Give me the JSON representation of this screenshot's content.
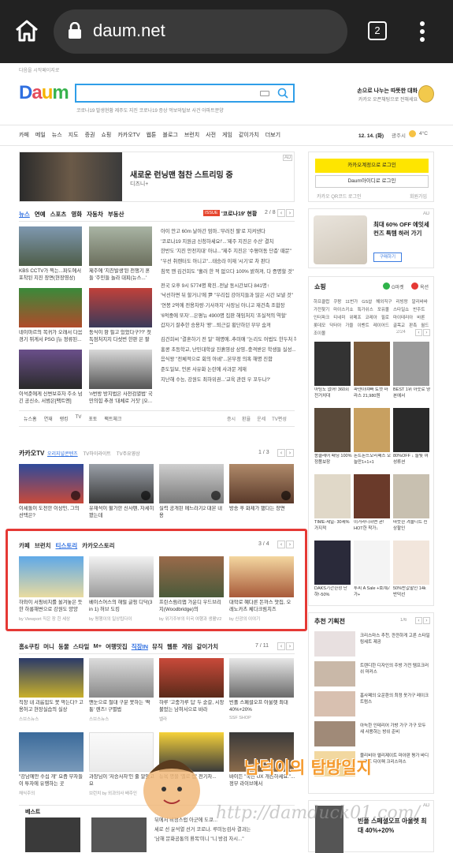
{
  "browser": {
    "url": "daum.net",
    "tab_count": "2"
  },
  "header": {
    "top_link": "다음을 시작페이지로",
    "logo": "Daum",
    "search_placeholder": "",
    "keywords": "코로나19 발생현황   제주도 지진   코로나19 증상   먹보와털보 사건  아파트분양",
    "promo_line1": "손으로 나누는 따뜻한 대화",
    "promo_line2": "카카오 오픈채팅으로 전해세요"
  },
  "gnb": {
    "items": [
      "카페",
      "메일",
      "뉴스",
      "지도",
      "증권",
      "쇼핑",
      "카카오TV",
      "웹툰",
      "블로그",
      "브런치",
      "사전",
      "게임",
      "같이가치",
      "더보기"
    ],
    "date": "12. 14. (화)",
    "weather_loc": "광주시",
    "temp": "4°C"
  },
  "banner": {
    "title": "새로운 런닝맨 첨찬 스트리밍 중",
    "sub": "디즈니+",
    "ad": "AD"
  },
  "login": {
    "kakao_btn": "카카오계정으로 로그인",
    "daum_btn": "Daum아이디로 로그인",
    "qr": "카카오 QR코드 로그인",
    "signup": "회원가입"
  },
  "news": {
    "tabs": [
      "뉴스",
      "연예",
      "스포츠",
      "영화",
      "자동차",
      "부동산"
    ],
    "issue_label": "ISSUE",
    "issue_text": "'코로나19' 현황",
    "page": "2 / 8",
    "thumbs": [
      {
        "cap": "KBS CCTV가 찍는...파도에서 포착된 지진 장면(현장영상)"
      },
      {
        "cap": "제주에 '지진발생'된 전쟁기 혼들 '주민들 놀라 대피(뉴스...'"
      },
      {
        "cap": "네이마르의 복귀가 오래서 다음 경기 뛰게서 PSG [뉴 정류된..."
      },
      {
        "cap": "동식이 항 필고 있었다구??' 첫 독점처지지 다섯번 한판 은 팔렸..."
      },
      {
        "cap": "이석준에게 신변보호자 주소 넘긴 공신소, 서범은[팩트엔]"
      },
      {
        "cap": "'n번방 방지법은 사전검열법' 국민의힘 추경 '대체로 거짓' [오..."
      }
    ],
    "lines": [
      "아이 안고 60m 날아간 엄마..'부러진 팔'로 지켜낸다",
      "'코로나19 지원금 신청하세요!'...'제주 지진은 수산' 결치",
      "한반도 '지진 안전지대' 아냐...\"제주 지진은 '수평이동 단층' 때문\"",
      "\"우선 취렌터도 아니고\"...태승라 이재 '시기'로 차 판다",
      "침묵 깬 김건희도 \"흘러 한 적 없으다 100% 밝혀져, 다 증명할 것\"",
      "",
      "전국 오후 9시 5774명 확진..전날 동시간보다 841명↑",
      "'낙선하면 뒤 할거니'에 尹 \"우리집 강아지들과 많은 시간 보낼 것\"",
      "'연봉 2억에 전용차량·기사까지' 사장님 아니고 재건축 조합장",
      "'6억중에 또자'...은평뉴 4900명 집판 해임처지 '초실적의 역할'",
      "갑자기 잘추한 승용차 '꽝'...퇴근길 횡단하던 부부 숨져",
      "",
      "김건희씨 \"결혼하기 전 일\" 해명에..추미애 \"논리도 어법도 한두처 헤\"",
      "홍콩 초등학교, 난민대학살 진흙영상 상영..충격받은 학생들 실성...",
      "음식왕 \"전체적으로 회의 아녜\"...본부정 의혹 해명 진함",
      "준도일보, 언론 사유화 논란에 사과문 게재",
      "지난해 수능, 강원도 최하위권...'교육 관련 우 꼬두나?'"
    ],
    "sub_tabs": [
      "뉴스홈",
      "연재",
      "랭킹",
      "TV",
      "포토",
      "팩트체크"
    ],
    "right_links": [
      "증시",
      "환율",
      "운세",
      "TV편성"
    ]
  },
  "kakaotv": {
    "title": "카카오TV",
    "tabs": [
      "오리지널콘텐츠",
      "TV하이라이트",
      "TV주요영상"
    ],
    "page": "1 / 3",
    "items": [
      {
        "cap": "이세돌이 도전한 이상민, 그의 선택은?"
      },
      {
        "cap": "유재석이 뮐가한 신사펜, 자세히 봤는데"
      },
      {
        "cap": "실력 공개된 메느라기2 대본 내용"
      },
      {
        "cap": "방송 후 화제가 됐다는 장면"
      }
    ]
  },
  "cafe": {
    "tabs": [
      "카페",
      "브런치",
      "티스토리",
      "카카오스토리"
    ],
    "page": "3 / 4",
    "items": [
      {
        "cap": "하와이 서핑비치를 올겨놓은 듯한 하롱해변으로 강원도 양양",
        "src": "by Viewport 직은 장 힌 세상"
      },
      {
        "cap": "베이스어스의 해럴 글핑 디닥(3 in 1) 허브 도킹",
        "src": "by 평행이의 일상팁다이"
      },
      {
        "cap": "프린스림리앱 가운디 우드브리지(Woodbridge)의",
        "src": "by 위기주부의 미국 여행과 생활V2"
      },
      {
        "cap": "대학로 혜다른 돈까스 맛집, 오레노카츠 체다크림치즈",
        "src": "by 신광의 이야기"
      }
    ]
  },
  "lifestyle": {
    "tabs": [
      "홈&쿠킹",
      "머니",
      "동물",
      "스타일",
      "M+",
      "여행맛집",
      "직장IN",
      "뮤직",
      "웹툰",
      "게임",
      "같이가치"
    ],
    "page": "7 / 11",
    "items": [
      {
        "cap": "직장 내 괴롭힘도 못 막는다? 고용허고 현장실습의 실상",
        "src": "스브스뉴스"
      },
      {
        "cap": "맨눈으로 절대 구분 못하는 '짝퉁' 렌즈! 구별법",
        "src": "스브스뉴스"
      },
      {
        "cap": "하루 '고충가루 딥' 두 숟갈, 시장 불었는 남혀서으로 바라",
        "src": "벨라"
      },
      {
        "cap": "빈폴 스페셜오프 아울렛 최대 40%+20%",
        "src": "SSF SHOP"
      },
      {
        "cap": "\"강남에만 수십 개\" 요즘 부자들이 투자에 유행하는 곳",
        "src": "채식주의"
      },
      {
        "cap": "과장님이 '저승사자'인 줄 알았고요",
        "src": "브런치 by 외과의사 배주인"
      },
      {
        "cap": "뉴욕 명물 '옐로 캡' 전기차...",
        "src": ""
      },
      {
        "cap": "바이든 \"국민 UX 개선하세요.\"...정부 라이브에서",
        "src": ""
      }
    ]
  },
  "best": {
    "title": "베스트",
    "lines": [
      "뒤에서 비정스럽 아군에 도쿄...",
      "세로 선 윤석열 선거 코로나. 루미능검사 결과는",
      "'남해 문화공통의 환복'미니 \"니 방검 자시...\""
    ]
  },
  "ad_right": {
    "title": "최대 60% OFF 에잇세컨즈 특템 하러 가기",
    "btn": "구매하기",
    "ad": "AD"
  },
  "shopping": {
    "title": "쇼핑",
    "g": "G마켓",
    "o": "옥션",
    "links": [
      "하프클럽",
      "쿠팡",
      "11번가",
      "GS샵",
      "해외직구",
      "리빙랑",
      "알리바바",
      "가전찾기",
      "마이스키쇼",
      "특가쉬스",
      "포유몰",
      "스타일쇼",
      "반주트",
      "인터파크",
      "티네미",
      "위메프",
      "코레아",
      "필로",
      "마이테리아",
      "바론",
      "롯데모",
      "닥터아",
      "가을",
      "이벤트",
      "레이어드",
      "골목교",
      "판촉",
      "월드",
      "조이몰"
    ],
    "page": "2/24",
    "items": [
      {
        "cap": "아팅도 없어! 360회전거치대",
        "price": ""
      },
      {
        "cap": "파덴이여빠 토캣 마라스 21,980원",
        "price": ""
      },
      {
        "cap": "BEST 1위 아웃로 양 본에서",
        "price": ""
      },
      {
        "cap": "몽클레어 패딩 100% 정품보장",
        "price": ""
      },
      {
        "cap": "돈트돈뜨오리패스 오늘만1+1+1",
        "price": ""
      },
      {
        "cap": "80%OFF ↓ 늘빛 여성류션",
        "price": ""
      },
      {
        "cap": "TIME-세일- 30세%가지적",
        "price": ""
      },
      {
        "cap": "이거라니하면 곧! HOT한 착가↓",
        "price": ""
      },
      {
        "cap": "따뜻한 겨울니트 신상할인",
        "price": ""
      },
      {
        "cap": "DAKS기간한정 단하!-50%",
        "price": ""
      },
      {
        "cap": "투씨 A Sale +호/특/가+",
        "price": ""
      },
      {
        "cap": "50%반값할인 14k 반덕선",
        "price": ""
      }
    ]
  },
  "recommend": {
    "title": "추천 기획전",
    "page": "1/6",
    "items": [
      "크리스마스 추천, 깐깐하게 고른 스타일링세트 제공",
      "트렌디한 디자인의 주방 가전 템프크러쉬 마커스",
      "홈사페의 오운환의 최정 옷가구 레이크 트럼스",
      "아늑한 인테리어 가방 가구 가구 모두 새 사용하는 방쉬 준비",
      "블리비아 엘리제이트 마아판 평가 바디 브랜드 다이렉 크리스마스"
    ]
  },
  "bottom_ad": {
    "title": "빈폴 스페셜오프 아울렛 최대 40%+20%",
    "ad": "AD"
  },
  "watermark": {
    "text": "남덕이의 탐방일지",
    "url": "http://damduck01.com/"
  }
}
